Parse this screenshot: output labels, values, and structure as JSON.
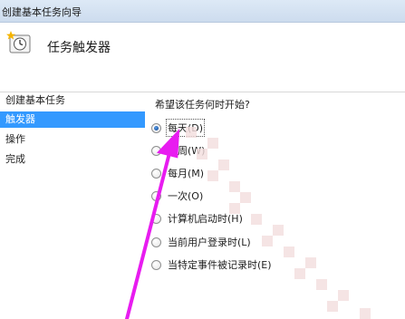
{
  "window": {
    "title": "创建基本任务向导"
  },
  "header": {
    "title": "任务触发器",
    "icon": "task-scheduler-clock-icon"
  },
  "sidebar": {
    "items": [
      {
        "label": "创建基本任务"
      },
      {
        "label": "触发器",
        "selected": true
      },
      {
        "label": "操作"
      },
      {
        "label": "完成"
      }
    ]
  },
  "main": {
    "question": "希望该任务何时开始?",
    "options": [
      {
        "text": "每天",
        "key": "(D)",
        "checked": true
      },
      {
        "text": "每周",
        "key": "(W)",
        "checked": false
      },
      {
        "text": "每月",
        "key": "(M)",
        "checked": false
      },
      {
        "text": "一次",
        "key": "(O)",
        "checked": false
      },
      {
        "text": "计算机启动时",
        "key": "(H)",
        "checked": false
      },
      {
        "text": "当前用户登录时",
        "key": "(L)",
        "checked": false
      },
      {
        "text": "当特定事件被记录时",
        "key": "(E)",
        "checked": false
      }
    ]
  },
  "colors": {
    "selection": "#3399ff",
    "annotation_arrow": "#e81cf0",
    "watermark": "#f3dede"
  }
}
